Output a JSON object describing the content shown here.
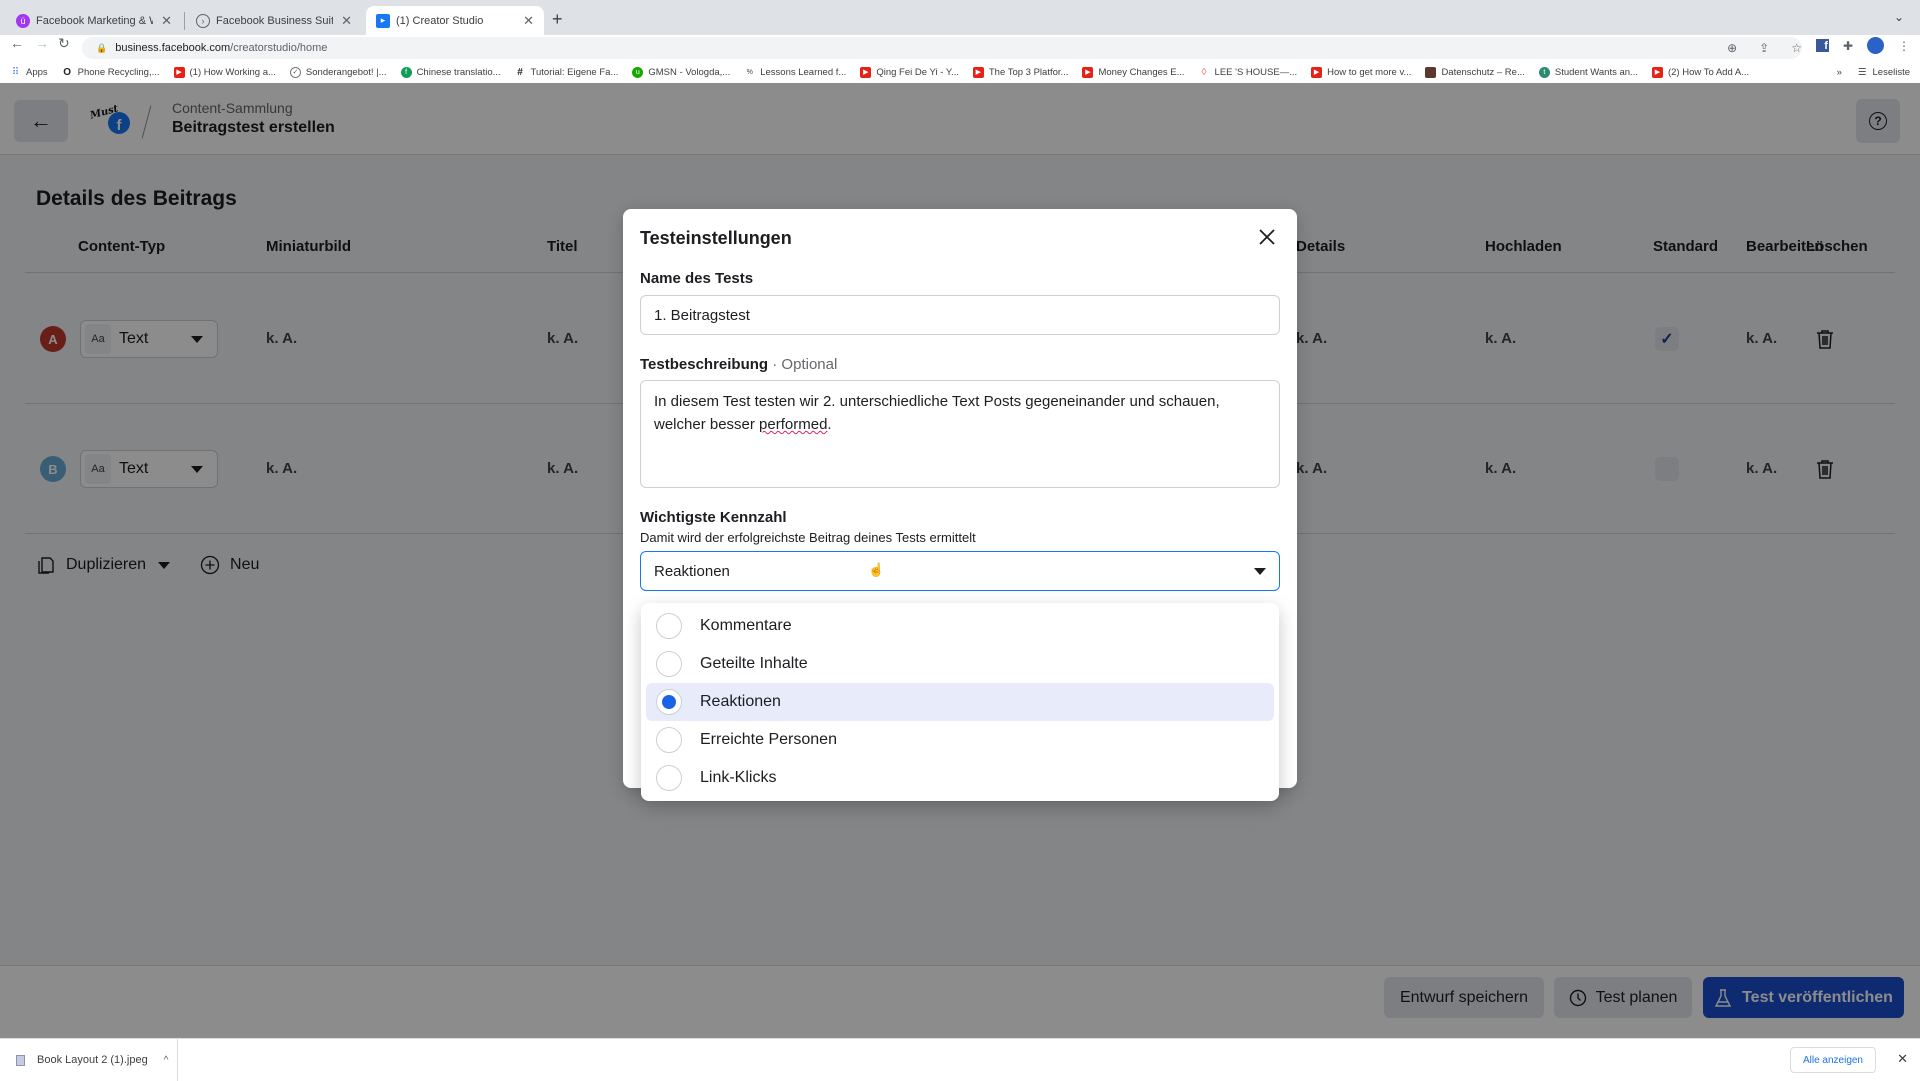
{
  "browser": {
    "tabs": [
      {
        "title": "Facebook Marketing & Werbea",
        "icon": "udemy-icon",
        "active": false
      },
      {
        "title": "Facebook Business Suite",
        "icon": "business-suite-icon",
        "active": false
      },
      {
        "title": "(1) Creator Studio",
        "icon": "creator-studio-icon",
        "active": true
      }
    ],
    "new_tab": "+",
    "url_host": "business.facebook.com",
    "url_path": "/creatorstudio/home",
    "bookmarks": [
      {
        "label": "Apps",
        "icon": "apps-grid-icon"
      },
      {
        "label": "Phone Recycling,...",
        "icon": "opera-icon"
      },
      {
        "label": "(1) How Working a...",
        "icon": "youtube-icon"
      },
      {
        "label": "Sonderangebot! |...",
        "icon": "bookmark-icon"
      },
      {
        "label": "Chinese translatio...",
        "icon": "translate-icon"
      },
      {
        "label": "Tutorial: Eigene Fa...",
        "icon": "hashtag-icon"
      },
      {
        "label": "GMSN - Vologda,...",
        "icon": "upwork-icon"
      },
      {
        "label": "Lessons Learned f...",
        "icon": "percent-icon"
      },
      {
        "label": "Qing Fei De Yi - Y...",
        "icon": "youtube-icon"
      },
      {
        "label": "The Top 3 Platfor...",
        "icon": "youtube-icon"
      },
      {
        "label": "Money Changes E...",
        "icon": "youtube-icon"
      },
      {
        "label": "LEE 'S HOUSE—...",
        "icon": "airbnb-icon"
      },
      {
        "label": "How to get more v...",
        "icon": "youtube-icon"
      },
      {
        "label": "Datenschutz – Re...",
        "icon": "bookmark-image-icon"
      },
      {
        "label": "Student Wants an...",
        "icon": "t-icon"
      },
      {
        "label": "(2) How To Add A...",
        "icon": "youtube-icon"
      }
    ],
    "bookmarks_overflow": "»",
    "reading_list": "Leseliste"
  },
  "header": {
    "logo_script": "Must",
    "breadcrumb_parent": "Content-Sammlung",
    "page_title": "Beitragstest erstellen"
  },
  "details": {
    "title": "Details des Beitrags",
    "columns": [
      "Content-Typ",
      "Miniaturbild",
      "Titel",
      "Details",
      "Hochladen",
      "Standard",
      "Bearbeiten",
      "Löschen"
    ],
    "rows": [
      {
        "badge": "A",
        "badge_color": "#c0392b",
        "content_type": "Text",
        "type_icon": "Aa",
        "thumbnail": "k. A.",
        "title": "k. A.",
        "details": "k. A.",
        "upload": "k. A.",
        "standard": true,
        "edit": "k. A."
      },
      {
        "badge": "B",
        "badge_color": "#6aa9d8",
        "content_type": "Text",
        "type_icon": "Aa",
        "thumbnail": "k. A.",
        "title": "k. A.",
        "details": "k. A.",
        "upload": "k. A.",
        "standard": false,
        "edit": "k. A."
      }
    ],
    "duplicate_label": "Duplizieren",
    "new_label": "Neu"
  },
  "footer": {
    "save_draft": "Entwurf speichern",
    "schedule": "Test planen",
    "publish": "Test veröffentlichen",
    "primary_color": "#1b4fd0"
  },
  "modal": {
    "title": "Testeinstellungen",
    "name_label": "Name des Tests",
    "name_value": "1. Beitragstest",
    "desc_label": "Testbeschreibung",
    "desc_optional": "· Optional",
    "desc_value_before": "In diesem Test testen wir 2. unterschiedliche Text Posts gegeneinander und schauen, welcher besser ",
    "desc_value_misspelled": "performed",
    "desc_value_after": ".",
    "metric_label": "Wichtigste Kennzahl",
    "metric_sub": "Damit wird der erfolgreichste Beitrag deines Tests ermittelt",
    "metric_value": "Reaktionen",
    "metric_options": [
      {
        "label": "Kommentare",
        "selected": false
      },
      {
        "label": "Geteilte Inhalte",
        "selected": false
      },
      {
        "label": "Reaktionen",
        "selected": true
      },
      {
        "label": "Erreichte Personen",
        "selected": false
      },
      {
        "label": "Link-Klicks",
        "selected": false
      }
    ]
  },
  "downloads": {
    "file_name": "Book Layout 2 (1).jpeg",
    "show_all": "Alle anzeigen"
  }
}
